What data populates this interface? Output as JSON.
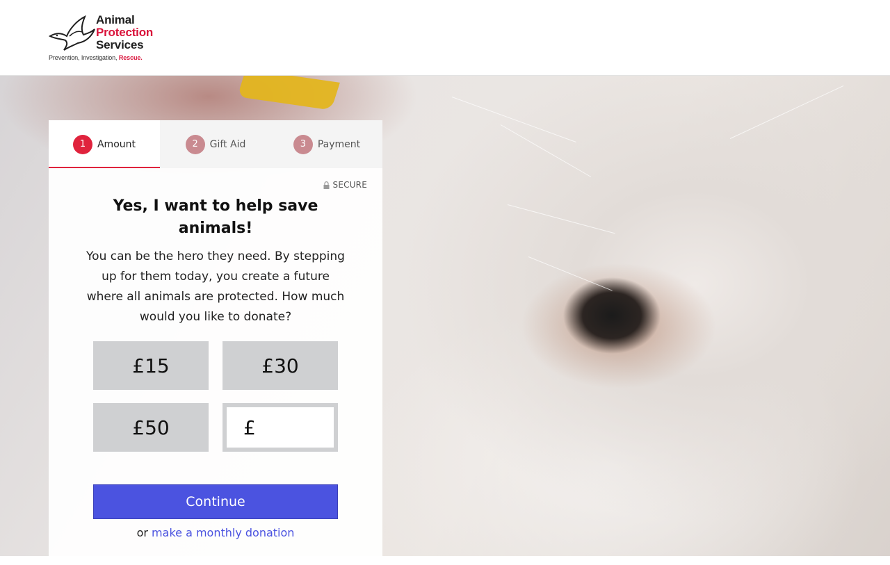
{
  "header": {
    "logo": {
      "line1": "Animal",
      "line2": "Protection",
      "line3": "Services",
      "tagline_prefix": "Prevention, Investigation, ",
      "tagline_rescue": "Rescue."
    }
  },
  "steps": [
    {
      "number": "1",
      "label": "Amount",
      "active": true
    },
    {
      "number": "2",
      "label": "Gift Aid",
      "active": false
    },
    {
      "number": "3",
      "label": "Payment",
      "active": false
    }
  ],
  "secure_label": "SECURE",
  "form": {
    "title": "Yes, I want to help save animals!",
    "description": "You can be the hero they need. By stepping up for them today, you create a future where all animals are protected. How much would you like to donate?",
    "amounts": [
      "£15",
      "£30",
      "£50"
    ],
    "custom_currency": "£",
    "custom_value": "",
    "continue_label": "Continue",
    "monthly_prefix": "or",
    "monthly_link": "make a monthly donation"
  },
  "colors": {
    "accent_red": "#e0233d",
    "brand_red": "#d9123a",
    "continue_blue": "#4b53e0",
    "amount_button_bg": "#cfd0d2"
  },
  "icons": {
    "logo": "dove-icon",
    "secure": "lock-icon"
  }
}
